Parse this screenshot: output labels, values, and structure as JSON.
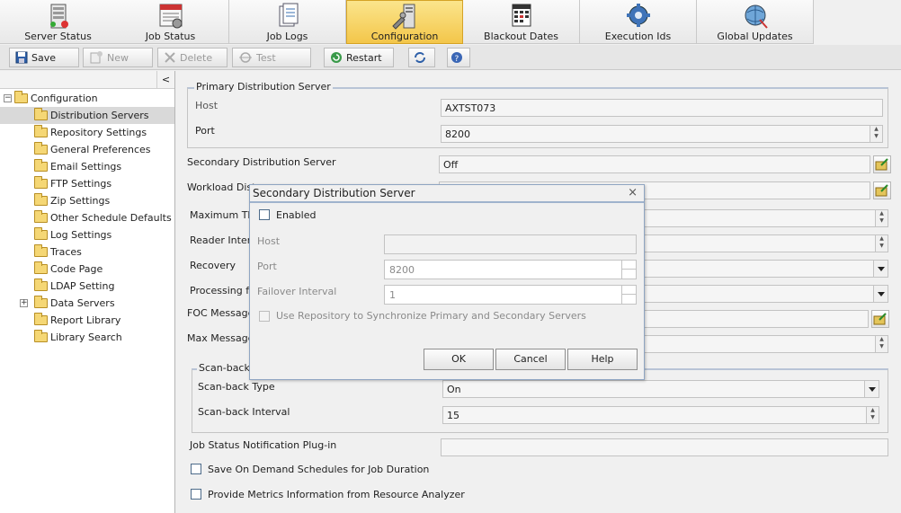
{
  "nav": {
    "tabs": [
      {
        "label": "Server Status",
        "icon": "server-status-icon"
      },
      {
        "label": "Job Status",
        "icon": "job-status-icon"
      },
      {
        "label": "Job Logs",
        "icon": "job-logs-icon"
      },
      {
        "label": "Configuration",
        "icon": "configuration-icon",
        "active": true
      },
      {
        "label": "Blackout Dates",
        "icon": "blackout-dates-icon"
      },
      {
        "label": "Execution Ids",
        "icon": "execution-ids-icon"
      },
      {
        "label": "Global Updates",
        "icon": "global-updates-icon"
      }
    ]
  },
  "toolbar": {
    "save": "Save",
    "new": "New",
    "delete": "Delete",
    "test": "Test",
    "restart": "Restart",
    "collapse": "<"
  },
  "tree": {
    "root": "Configuration",
    "items": [
      "Distribution Servers",
      "Repository Settings",
      "General Preferences",
      "Email Settings",
      "FTP Settings",
      "Zip Settings",
      "Other Schedule Defaults",
      "Log Settings",
      "Traces",
      "Code Page",
      "LDAP Setting",
      "Data Servers",
      "Report Library",
      "Library Search"
    ],
    "selected": "Distribution Servers"
  },
  "form": {
    "primary_group": "Primary Distribution Server",
    "host_label": "Host",
    "host_value": "AXTST073",
    "port_label": "Port",
    "port_value": "8200",
    "secondary_label": "Secondary Distribution Server",
    "secondary_value": "Off",
    "workload_label": "Workload Distr",
    "max_threads_label": "Maximum Thre",
    "reader_interval_label": "Reader Interv",
    "recovery_label": "Recovery",
    "processing_label": "Processing for",
    "foc_label": "FOC Message",
    "max_messages_label": "Max Messages",
    "scanback_group": "Scan-back",
    "scanback_type_label": "Scan-back Type",
    "scanback_type_value": "On",
    "scanback_interval_label": "Scan-back Interval",
    "scanback_interval_value": "15",
    "notification_label": "Job Status Notification Plug-in",
    "save_on_demand_label": "Save On Demand Schedules for Job Duration",
    "metrics_label": "Provide Metrics Information from Resource Analyzer"
  },
  "dialog": {
    "title": "Secondary Distribution Server",
    "close": "×",
    "enabled_label": "Enabled",
    "host_label": "Host",
    "port_label": "Port",
    "port_value": "8200",
    "failover_label": "Failover Interval",
    "failover_value": "1",
    "sync_label": "Use Repository to Synchronize Primary and Secondary Servers",
    "ok": "OK",
    "cancel": "Cancel",
    "help": "Help"
  },
  "colors": {
    "active_tab": "#f3c64a",
    "dialog_border": "#8fa5c2",
    "selected_row": "#d9d9d9"
  }
}
